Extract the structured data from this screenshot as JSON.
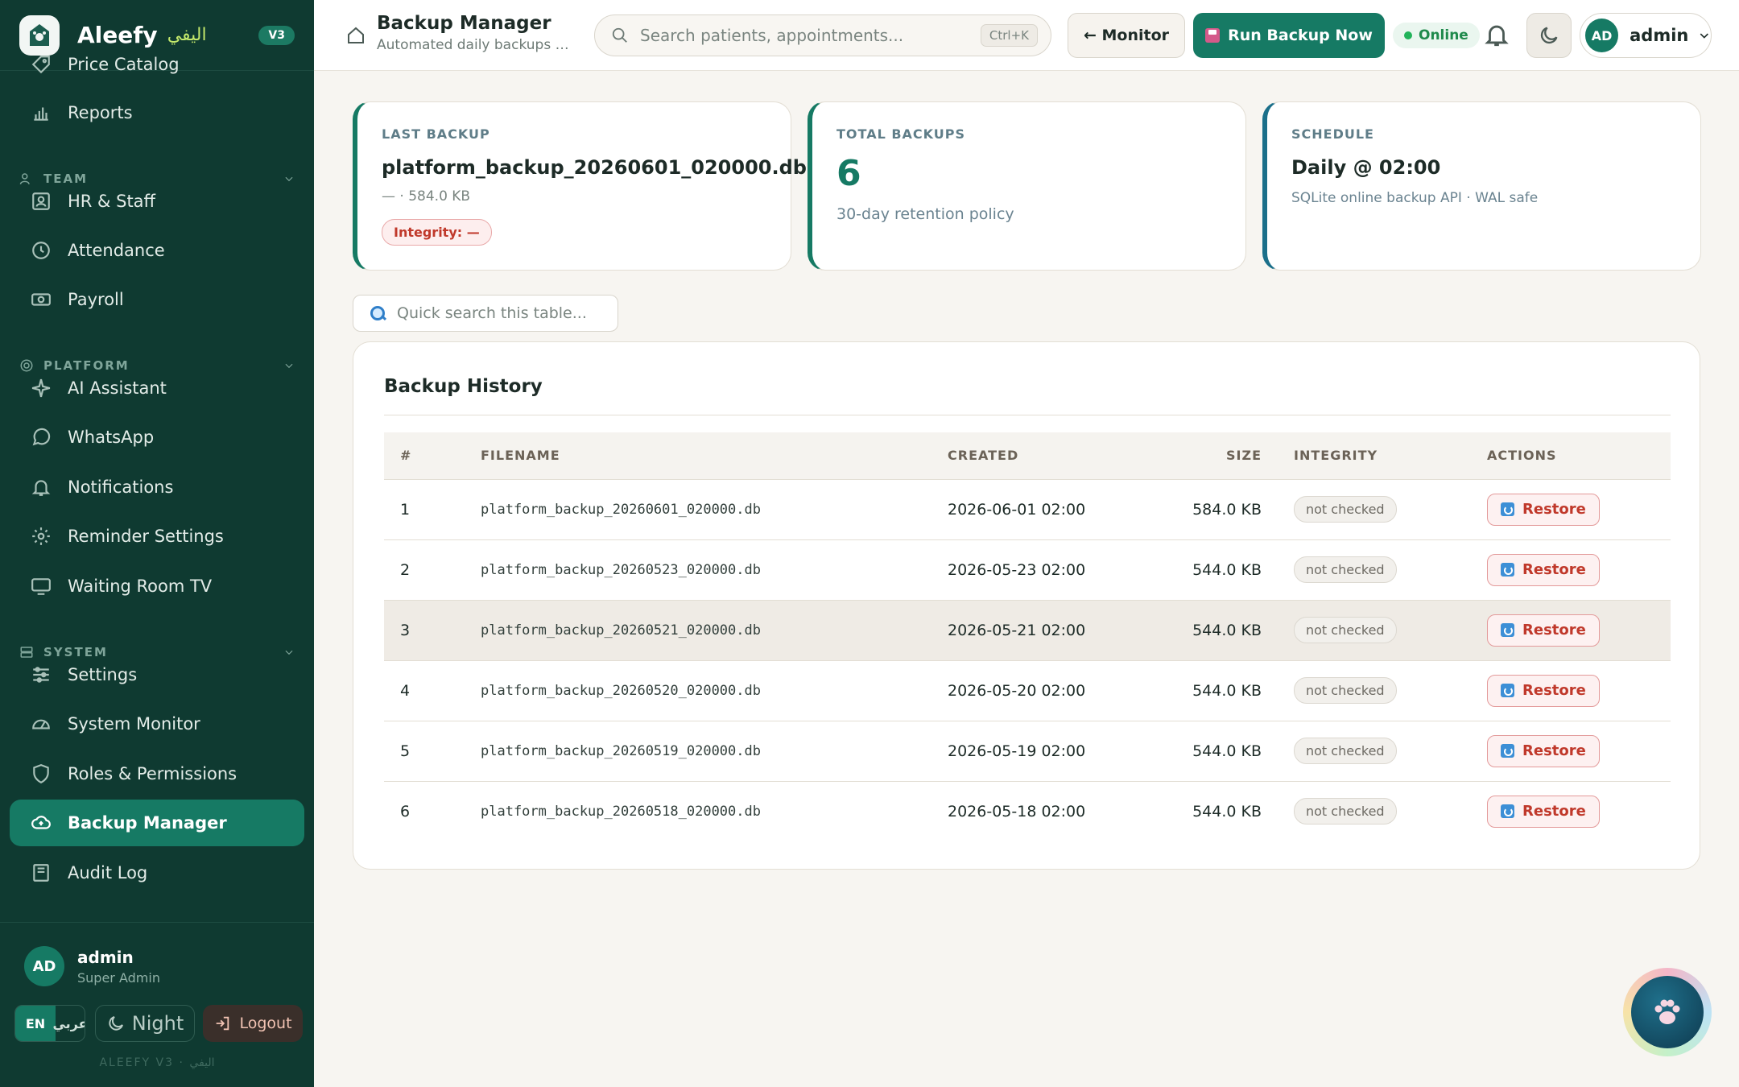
{
  "brand": {
    "name": "Aleefy",
    "name_ar": "اليفي",
    "version": "V3"
  },
  "sidebar": {
    "items": [
      {
        "label": "Price Catalog",
        "icon": "tag-icon"
      },
      {
        "label": "Reports",
        "icon": "bar-chart-icon"
      },
      {
        "label": "HR & Staff",
        "icon": "id-card-icon"
      },
      {
        "label": "Attendance",
        "icon": "clock-icon"
      },
      {
        "label": "Payroll",
        "icon": "money-icon"
      },
      {
        "label": "AI Assistant",
        "icon": "sparkle-icon"
      },
      {
        "label": "WhatsApp",
        "icon": "whatsapp-icon"
      },
      {
        "label": "Notifications",
        "icon": "bell-icon"
      },
      {
        "label": "Reminder Settings",
        "icon": "gear-icon"
      },
      {
        "label": "Waiting Room TV",
        "icon": "tv-icon"
      },
      {
        "label": "Settings",
        "icon": "sliders-icon"
      },
      {
        "label": "System Monitor",
        "icon": "gauge-icon"
      },
      {
        "label": "Roles & Permissions",
        "icon": "shield-icon"
      },
      {
        "label": "Backup Manager",
        "icon": "cloud-upload-icon"
      },
      {
        "label": "Audit Log",
        "icon": "book-icon"
      }
    ],
    "sections": {
      "team": "TEAM",
      "platform": "PLATFORM",
      "system": "SYSTEM"
    },
    "user": {
      "initials": "AD",
      "name": "admin",
      "role": "Super Admin"
    },
    "lang_en": "EN",
    "lang_ar": "عربي",
    "night_label": "Night",
    "logout_label": "Logout",
    "footer": "ALEEFY V3 · اليفي"
  },
  "header": {
    "title": "Backup Manager",
    "subtitle": "Automated daily backups + ...",
    "search_placeholder": "Search patients, appointments...",
    "search_shortcut": "Ctrl+K",
    "monitor_label": "← Monitor",
    "run_label": "Run Backup Now",
    "status": "Online",
    "user_initials": "AD",
    "user_name": "admin"
  },
  "cards": {
    "last_backup": {
      "label": "LAST BACKUP",
      "value": "platform_backup_20260601_020000.db",
      "sub": "— · 584.0 KB",
      "integrity": "Integrity: —"
    },
    "total": {
      "label": "TOTAL BACKUPS",
      "value": "6",
      "sub": "30-day retention policy"
    },
    "schedule": {
      "label": "SCHEDULE",
      "value": "Daily @ 02:00",
      "sub": "SQLite online backup API · WAL safe"
    }
  },
  "quick_search_placeholder": "Quick search this table...",
  "history": {
    "title": "Backup History",
    "columns": [
      "#",
      "FILENAME",
      "CREATED",
      "SIZE",
      "INTEGRITY",
      "ACTIONS"
    ],
    "restore_label": "Restore",
    "rows": [
      {
        "num": "1",
        "file": "platform_backup_20260601_020000.db",
        "created": "2026-06-01 02:00",
        "size": "584.0 KB",
        "integrity": "not checked"
      },
      {
        "num": "2",
        "file": "platform_backup_20260523_020000.db",
        "created": "2026-05-23 02:00",
        "size": "544.0 KB",
        "integrity": "not checked"
      },
      {
        "num": "3",
        "file": "platform_backup_20260521_020000.db",
        "created": "2026-05-21 02:00",
        "size": "544.0 KB",
        "integrity": "not checked"
      },
      {
        "num": "4",
        "file": "platform_backup_20260520_020000.db",
        "created": "2026-05-20 02:00",
        "size": "544.0 KB",
        "integrity": "not checked"
      },
      {
        "num": "5",
        "file": "platform_backup_20260519_020000.db",
        "created": "2026-05-19 02:00",
        "size": "544.0 KB",
        "integrity": "not checked"
      },
      {
        "num": "6",
        "file": "platform_backup_20260518_020000.db",
        "created": "2026-05-18 02:00",
        "size": "544.0 KB",
        "integrity": "not checked"
      }
    ]
  },
  "colors": {
    "primary": "#167a64",
    "sidebar": "#0f3a31",
    "danger": "#c0392b",
    "online": "#22b35a"
  }
}
